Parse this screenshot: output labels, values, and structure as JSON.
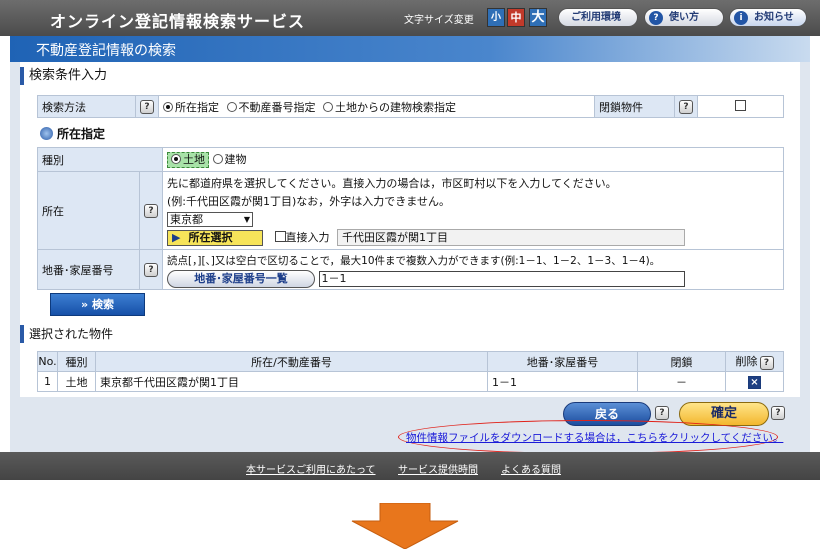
{
  "header": {
    "title": "オンライン登記情報検索サービス",
    "font_size_label": "文字サイズ変更",
    "font_sizes": [
      "小",
      "中",
      "大"
    ],
    "env_label": "ご利用環境",
    "usage_label": "使い方",
    "news_label": "お知らせ",
    "help_glyph": "?",
    "info_glyph": "i"
  },
  "page_title": "不動産登記情報の検索",
  "search_conditions": {
    "heading": "検索条件入力",
    "method_label": "検索方法",
    "methods": [
      "所在指定",
      "不動産番号指定",
      "土地からの建物検索指定"
    ],
    "closed_label": "閉鎖物件"
  },
  "location_section": {
    "heading": "所在指定",
    "type_label": "種別",
    "types": [
      "土地",
      "建物"
    ],
    "location_label": "所在",
    "instruction_line1": "先に都道府県を選択してください。直接入力の場合は，市区町村以下を入力してください。",
    "instruction_line2": "(例:千代田区霞が関1丁目)なお，外字は入力できません。",
    "prefecture_value": "東京都",
    "select_button": "所在選択",
    "direct_input_label": "直接入力",
    "location_value": "千代田区霞が関1丁目",
    "lot_label": "地番･家屋番号",
    "lot_instruction": "読点[，][、]又は空白で区切ることで，最大10件まで複数入力ができます(例:1－1、1－2、1－3、1－4)。",
    "lot_list_button": "地番･家屋番号一覧",
    "lot_value": "1－1"
  },
  "search_button": "» 検索",
  "selected": {
    "heading": "選択された物件",
    "columns": [
      "No.",
      "種別",
      "所在/不動産番号",
      "地番･家屋番号",
      "閉鎖",
      "削除"
    ],
    "rows": [
      {
        "no": "1",
        "type": "土地",
        "location": "東京都千代田区霞が関1丁目",
        "lot": "1－1",
        "closed": "－",
        "delete_mark": "×"
      }
    ]
  },
  "back_button": "戻る",
  "confirm_button": "確定",
  "download_link": "物件情報ファイルをダウンロードする場合は，こちらをクリックしてください。",
  "footer_links": [
    "本サービスご利用にあたって",
    "サービス提供時間",
    "よくある質問"
  ],
  "colors": {
    "accent": "#1f63b5",
    "arrow": "#e8761c",
    "highlight": "#e0231b"
  }
}
